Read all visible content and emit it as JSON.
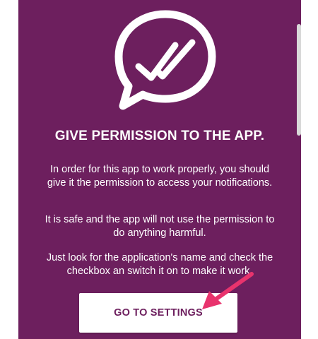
{
  "permission": {
    "title": "GIVE PERMISSION TO THE APP.",
    "paragraph_1": "In order for this app to work properly, you should give it the permission to access your notifications.",
    "paragraph_2": "It is safe and the app will not use the permission to do anything harmful.",
    "paragraph_3": "Just look for the application's name and check the checkbox an switch it on to make it work.",
    "button_label": "GO TO SETTINGS"
  },
  "icons": {
    "logo": "chat-bubble-double-check-icon",
    "annotation": "pink-arrow-icon"
  },
  "colors": {
    "background": "#6d1f5e",
    "text": "#ffffff",
    "button_background": "#ffffff",
    "button_text": "#6d1f5e",
    "arrow": "#e8336d"
  }
}
